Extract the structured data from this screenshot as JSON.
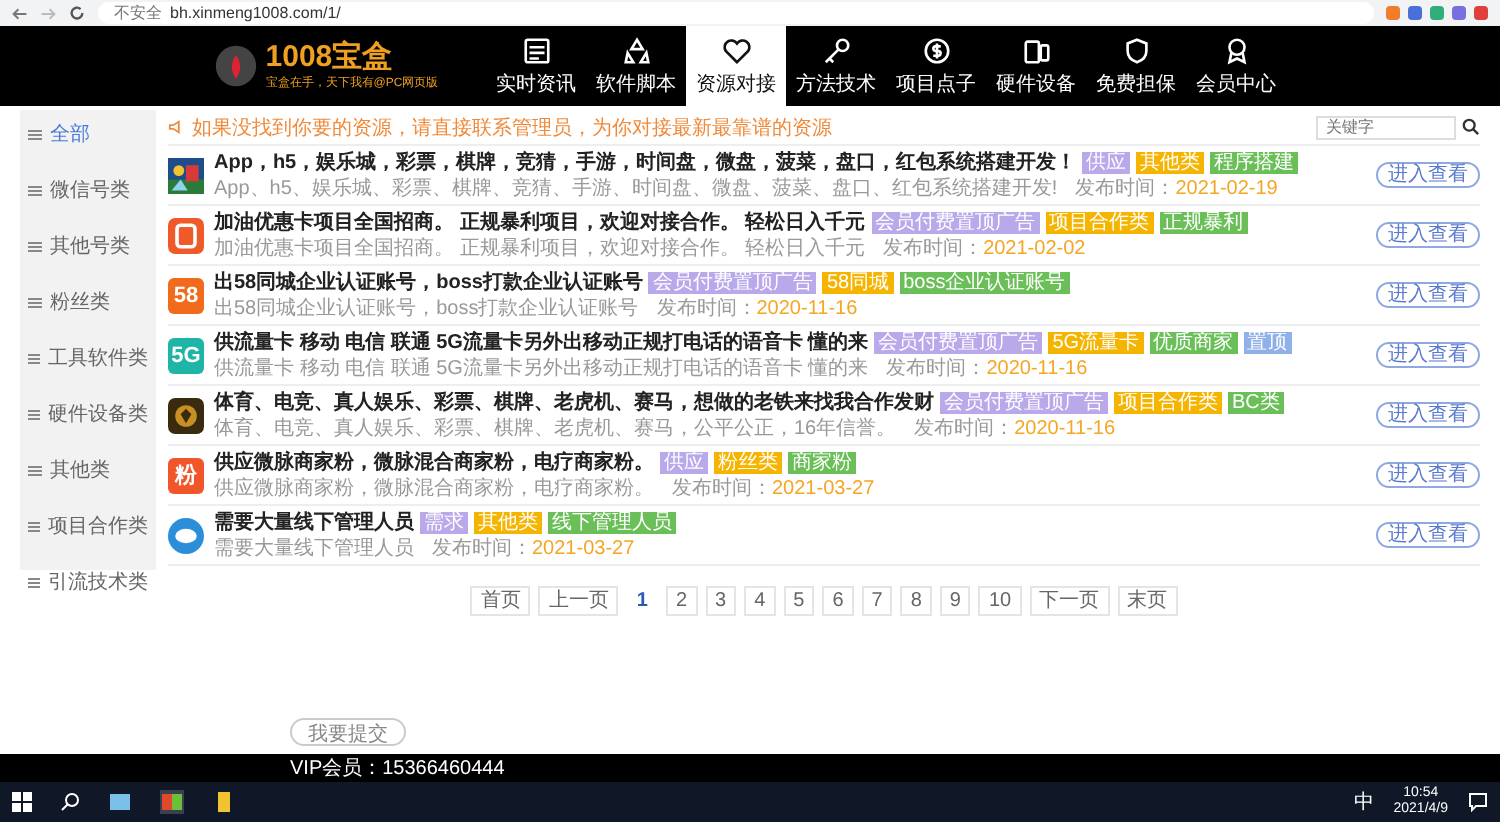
{
  "browser": {
    "security": "不安全",
    "url": "bh.xinmeng1008.com/1/"
  },
  "header": {
    "logo": "1008宝盒",
    "slogan": "宝盒在手，天下我有@PC网页版",
    "nav": [
      {
        "label": "实时资讯",
        "selected": false
      },
      {
        "label": "软件脚本",
        "selected": false
      },
      {
        "label": "资源对接",
        "selected": true
      },
      {
        "label": "方法技术",
        "selected": false
      },
      {
        "label": "项目点子",
        "selected": false
      },
      {
        "label": "硬件设备",
        "selected": false
      },
      {
        "label": "免费担保",
        "selected": false
      },
      {
        "label": "会员中心",
        "selected": false
      }
    ]
  },
  "sidebar": {
    "items": [
      {
        "label": "全部",
        "selected": true
      },
      {
        "label": "微信号类",
        "selected": false
      },
      {
        "label": "其他号类",
        "selected": false
      },
      {
        "label": "粉丝类",
        "selected": false
      },
      {
        "label": "工具软件类",
        "selected": false
      },
      {
        "label": "硬件设备类",
        "selected": false
      },
      {
        "label": "其他类",
        "selected": false
      },
      {
        "label": "项目合作类",
        "selected": false
      },
      {
        "label": "引流技术类",
        "selected": false
      }
    ]
  },
  "notice": "如果没找到你要的资源，请直接联系管理员，为你对接最新最靠谱的资源",
  "search": {
    "placeholder": "关键字"
  },
  "listings": [
    {
      "icon": {
        "kind": "picture"
      },
      "title": "App，h5，娱乐城，彩票，棋牌，竞猜，手游，时间盘，微盘，菠菜，盘口，红包系统搭建开发！",
      "summary": "App、h5、娱乐城、彩票、棋牌、竞猜、手游、时间盘、微盘、菠菜、盘口、红包系统搭建开发!",
      "tags": [
        {
          "label": "供应",
          "color": "#b9a8ea"
        },
        {
          "label": "其他类",
          "color": "#f5b400"
        },
        {
          "label": "程序搭建",
          "color": "#6bbf59"
        }
      ],
      "date_label": "发布时间：",
      "date": "2021-02-19",
      "button": "进入查看"
    },
    {
      "icon": {
        "kind": "card",
        "color": "#ef5a28"
      },
      "title": "加油优惠卡项目全国招商。 正规暴利项目，欢迎对接合作。 轻松日入千元",
      "summary": "加油优惠卡项目全国招商。 正规暴利项目，欢迎对接合作。 轻松日入千元",
      "tags": [
        {
          "label": "会员付费置顶广告",
          "color": "#b9a8ea"
        },
        {
          "label": "项目合作类",
          "color": "#f5b400"
        },
        {
          "label": "正规暴利",
          "color": "#6bbf59"
        }
      ],
      "date_label": "发布时间：",
      "date": "2021-02-02",
      "button": "进入查看"
    },
    {
      "icon": {
        "kind": "text",
        "text": "58",
        "color": "#f26a1b"
      },
      "title": "出58同城企业认证账号，boss打款企业认证账号",
      "summary": "出58同城企业认证账号，boss打款企业认证账号",
      "tags": [
        {
          "label": "会员付费置顶广告",
          "color": "#b9a8ea"
        },
        {
          "label": "58同城",
          "color": "#f5b400"
        },
        {
          "label": "boss企业认证账号",
          "color": "#6bbf59"
        }
      ],
      "date_label": "发布时间：",
      "date": "2020-11-16",
      "button": "进入查看"
    },
    {
      "icon": {
        "kind": "text",
        "text": "5G",
        "color": "#1fb5a6"
      },
      "title": "供流量卡 移动 电信 联通 5G流量卡另外出移动正规打电话的语音卡 懂的来",
      "summary": "供流量卡 移动 电信 联通 5G流量卡另外出移动正规打电话的语音卡 懂的来",
      "tags": [
        {
          "label": "会员付费置顶广告",
          "color": "#b9a8ea"
        },
        {
          "label": "5G流量卡",
          "color": "#f5b400"
        },
        {
          "label": "优质商家",
          "color": "#6bbf59"
        },
        {
          "label": "置顶",
          "color": "#8fb0e8"
        }
      ],
      "date_label": "发布时间：",
      "date": "2020-11-16",
      "button": "进入查看"
    },
    {
      "icon": {
        "kind": "badge",
        "color": "#3a2a10"
      },
      "title": "体育、电竞、真人娱乐、彩票、棋牌、老虎机、赛马，想做的老铁来找我合作发财",
      "summary": "体育、电竞、真人娱乐、彩票、棋牌、老虎机、赛马，公平公正，16年信誉。",
      "tags": [
        {
          "label": "会员付费置顶广告",
          "color": "#b9a8ea"
        },
        {
          "label": "项目合作类",
          "color": "#f5b400"
        },
        {
          "label": "BC类",
          "color": "#6bbf59"
        }
      ],
      "date_label": "发布时间：",
      "date": "2020-11-16",
      "button": "进入查看"
    },
    {
      "icon": {
        "kind": "text",
        "text": "粉",
        "color": "#f0562a"
      },
      "title": "供应微脉商家粉，微脉混合商家粉，电疗商家粉。",
      "summary": "供应微脉商家粉，微脉混合商家粉，电疗商家粉。",
      "tags": [
        {
          "label": "供应",
          "color": "#b9a8ea"
        },
        {
          "label": "粉丝类",
          "color": "#f5b400"
        },
        {
          "label": "商家粉",
          "color": "#6bbf59"
        }
      ],
      "date_label": "发布时间：",
      "date": "2021-03-27",
      "button": "进入查看"
    },
    {
      "icon": {
        "kind": "circle",
        "color": "#2a8fd8"
      },
      "title": "需要大量线下管理人员",
      "summary": "需要大量线下管理人员",
      "tags": [
        {
          "label": "需求",
          "color": "#b9a8ea"
        },
        {
          "label": "其他类",
          "color": "#f5b400"
        },
        {
          "label": "线下管理人员",
          "color": "#6bbf59"
        }
      ],
      "date_label": "发布时间：",
      "date": "2021-03-27",
      "button": "进入查看"
    }
  ],
  "pagination": [
    {
      "label": "首页",
      "selected": false
    },
    {
      "label": "上一页",
      "selected": false
    },
    {
      "label": "1",
      "selected": true
    },
    {
      "label": "2",
      "selected": false
    },
    {
      "label": "3",
      "selected": false
    },
    {
      "label": "4",
      "selected": false
    },
    {
      "label": "5",
      "selected": false
    },
    {
      "label": "6",
      "selected": false
    },
    {
      "label": "7",
      "selected": false
    },
    {
      "label": "8",
      "selected": false
    },
    {
      "label": "9",
      "selected": false
    },
    {
      "label": "10",
      "selected": false
    },
    {
      "label": "下一页",
      "selected": false
    },
    {
      "label": "末页",
      "selected": false
    }
  ],
  "submit_button": "我要提交",
  "footer": "VIP会员：15366460444",
  "taskbar": {
    "ime": "中",
    "time": "10:54",
    "date": "2021/4/9"
  }
}
